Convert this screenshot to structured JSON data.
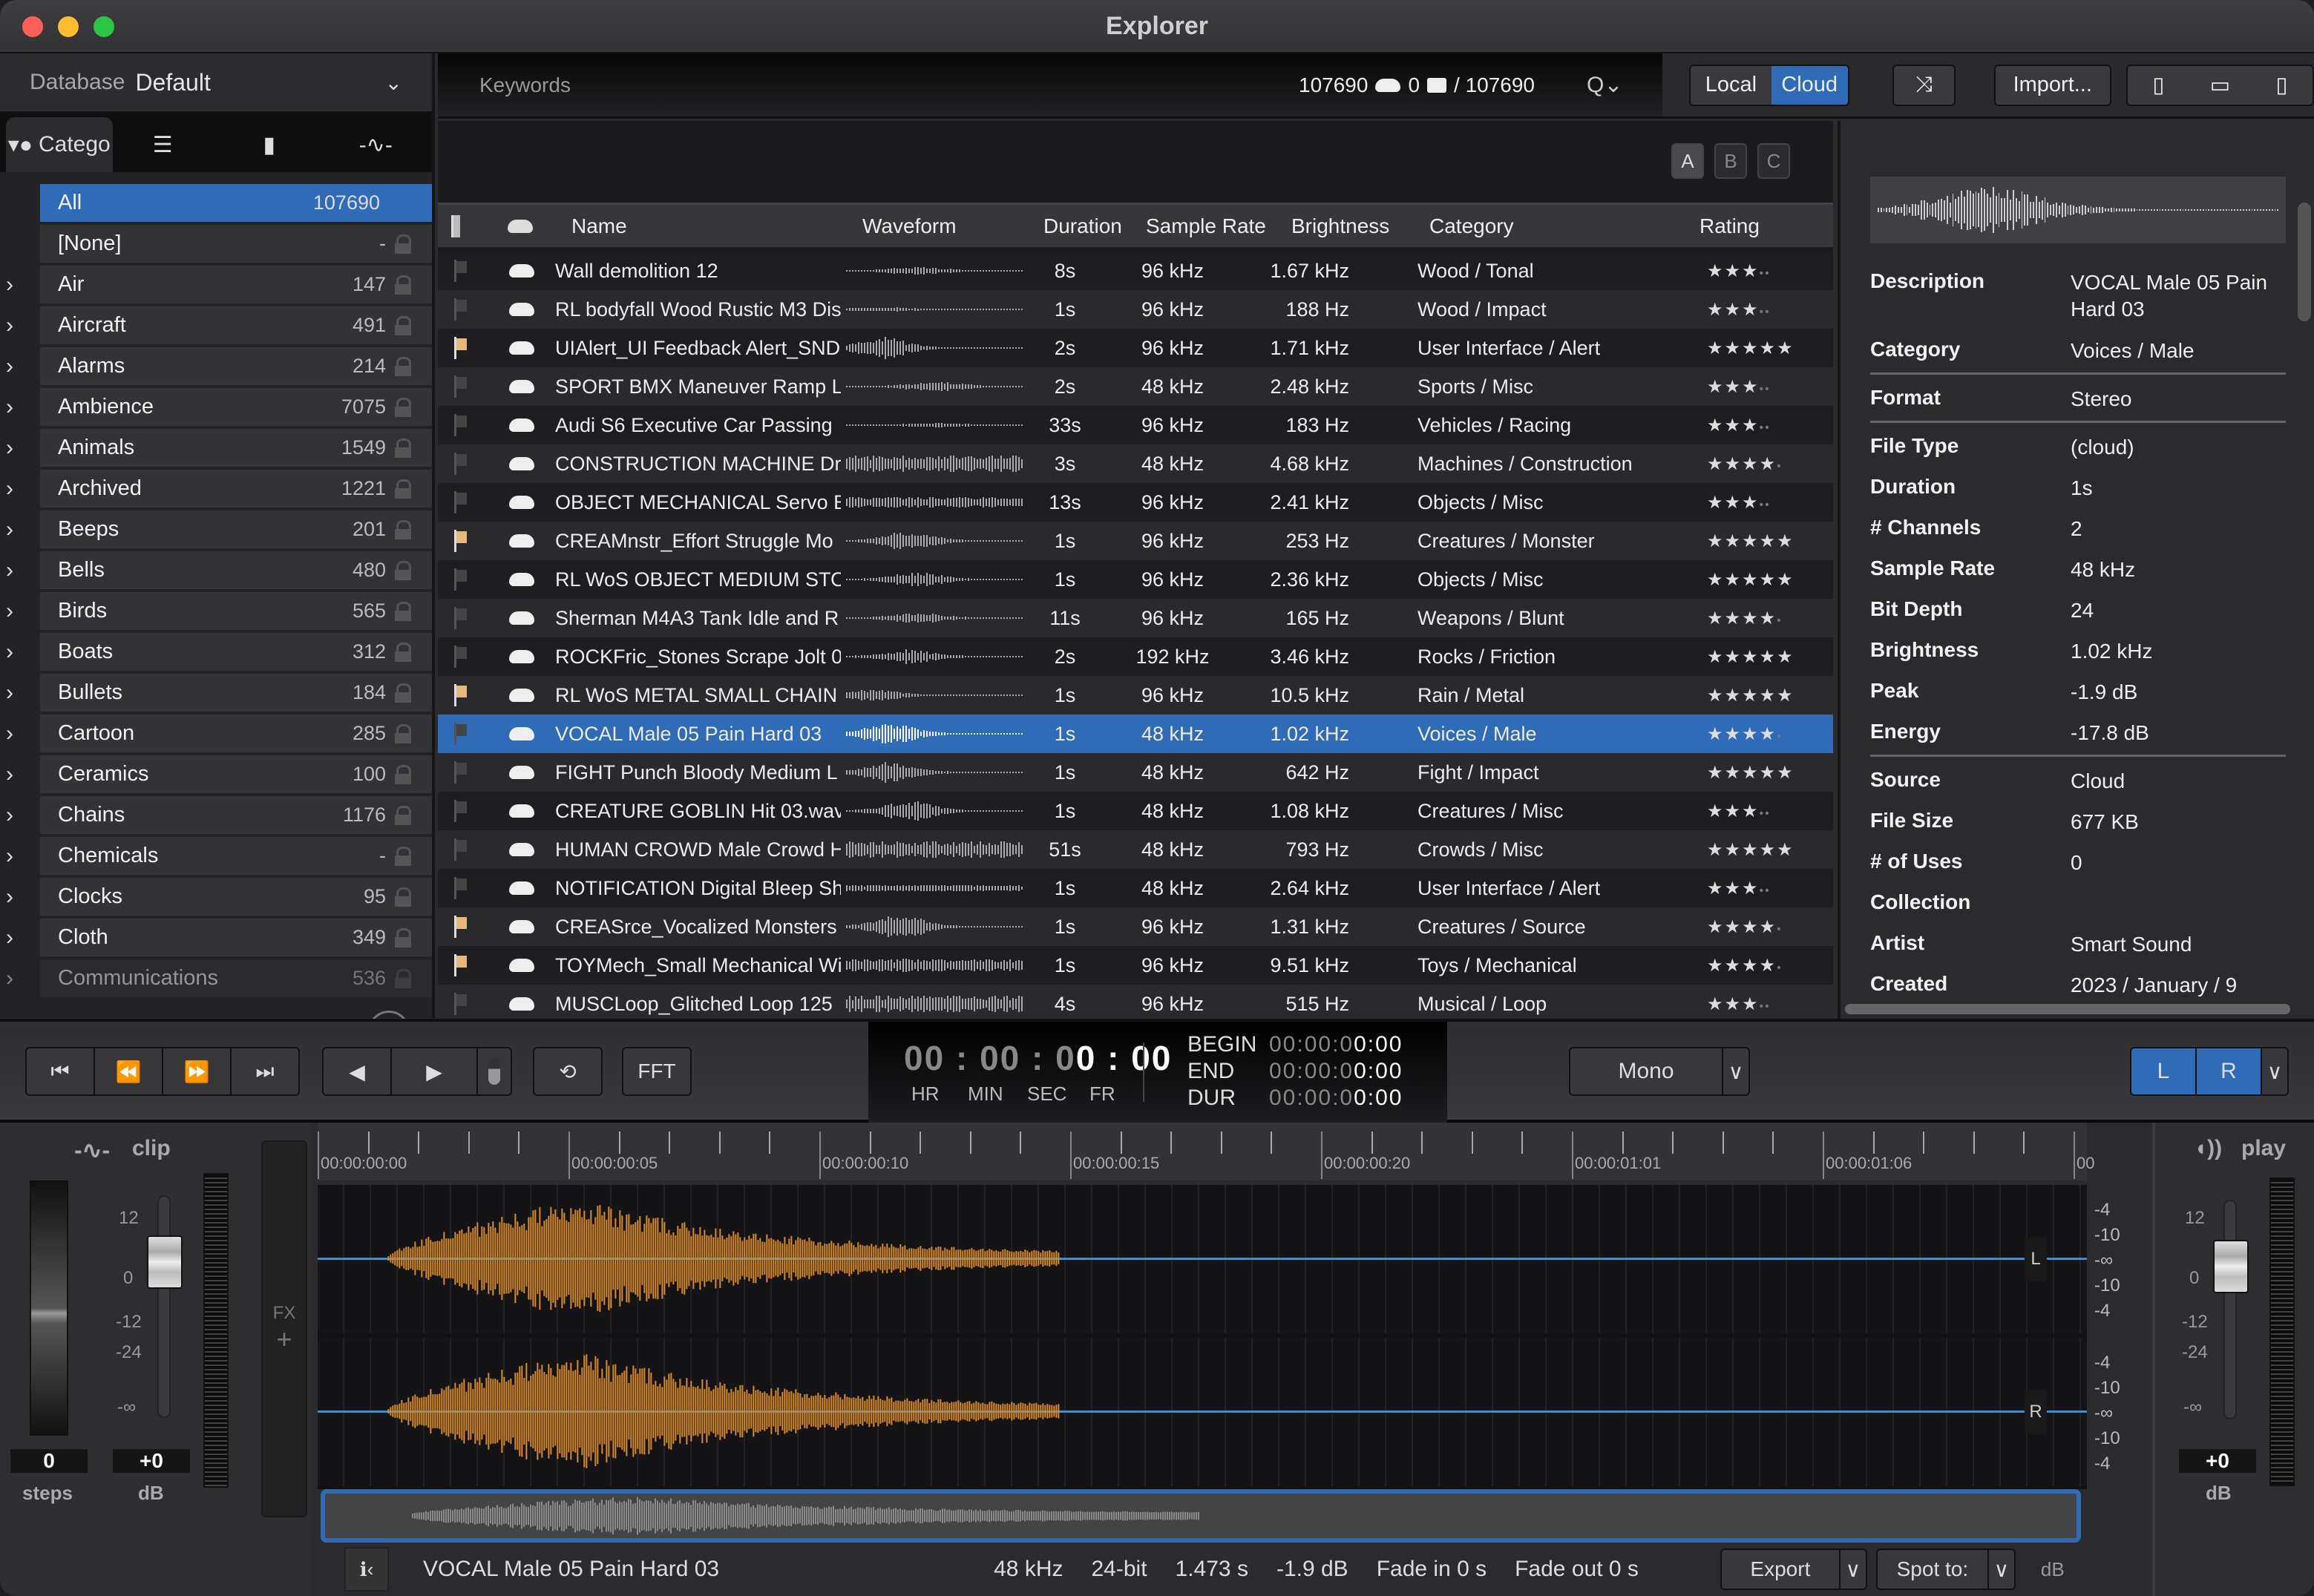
{
  "window": {
    "title": "Explorer"
  },
  "sidebar": {
    "database_label": "Database",
    "database_value": "Default",
    "tabs": [
      {
        "label": "Catego",
        "icon": "category-icon"
      },
      {
        "label": "",
        "icon": "list-icon"
      },
      {
        "label": "",
        "icon": "folder-icon"
      },
      {
        "label": "",
        "icon": "waveform-icon"
      }
    ],
    "categories": [
      {
        "name": "All",
        "count": "107690",
        "selected": true,
        "expandable": false
      },
      {
        "name": "[None]",
        "count": "-",
        "expandable": false
      },
      {
        "name": "Air",
        "count": "147",
        "expandable": true
      },
      {
        "name": "Aircraft",
        "count": "491",
        "expandable": true
      },
      {
        "name": "Alarms",
        "count": "214",
        "expandable": true
      },
      {
        "name": "Ambience",
        "count": "7075",
        "expandable": true
      },
      {
        "name": "Animals",
        "count": "1549",
        "expandable": true
      },
      {
        "name": "Archived",
        "count": "1221",
        "expandable": true
      },
      {
        "name": "Beeps",
        "count": "201",
        "expandable": true
      },
      {
        "name": "Bells",
        "count": "480",
        "expandable": true
      },
      {
        "name": "Birds",
        "count": "565",
        "expandable": true
      },
      {
        "name": "Boats",
        "count": "312",
        "expandable": true
      },
      {
        "name": "Bullets",
        "count": "184",
        "expandable": true
      },
      {
        "name": "Cartoon",
        "count": "285",
        "expandable": true
      },
      {
        "name": "Ceramics",
        "count": "100",
        "expandable": true
      },
      {
        "name": "Chains",
        "count": "1176",
        "expandable": true
      },
      {
        "name": "Chemicals",
        "count": "-",
        "expandable": true
      },
      {
        "name": "Clocks",
        "count": "95",
        "expandable": true
      },
      {
        "name": "Cloth",
        "count": "349",
        "expandable": true
      },
      {
        "name": "Communications",
        "count": "536",
        "expandable": true
      }
    ]
  },
  "search": {
    "placeholder": "Keywords",
    "cloud_count": "107690",
    "local_count": "0",
    "total": "/ 107690"
  },
  "toolbar": {
    "local_label": "Local",
    "cloud_label": "Cloud",
    "active_source": "Cloud",
    "import_label": "Import...",
    "abc": [
      "A",
      "B",
      "C"
    ]
  },
  "table": {
    "columns": [
      "Name",
      "Waveform",
      "Duration",
      "Sample Rate",
      "Brightness",
      "Category",
      "Rating"
    ],
    "rows": [
      {
        "flag": false,
        "name": "Wall demolition 12",
        "duration": "8s",
        "sample_rate": "96 kHz",
        "brightness": "1.67 kHz",
        "category": "Wood / Tonal",
        "rating": 3
      },
      {
        "flag": false,
        "name": "RL bodyfall Wood Rustic M3 Dis",
        "duration": "1s",
        "sample_rate": "96 kHz",
        "brightness": "188 Hz",
        "category": "Wood / Impact",
        "rating": 3
      },
      {
        "flag": true,
        "name": "UIAlert_UI Feedback Alert_SND",
        "duration": "2s",
        "sample_rate": "96 kHz",
        "brightness": "1.71 kHz",
        "category": "User Interface / Alert",
        "rating": 5
      },
      {
        "flag": false,
        "name": "SPORT BMX Maneuver Ramp L",
        "duration": "2s",
        "sample_rate": "48 kHz",
        "brightness": "2.48 kHz",
        "category": "Sports / Misc",
        "rating": 3
      },
      {
        "flag": false,
        "name": "Audi S6 Executive Car  Passing",
        "duration": "33s",
        "sample_rate": "96 kHz",
        "brightness": "183 Hz",
        "category": "Vehicles / Racing",
        "rating": 3
      },
      {
        "flag": false,
        "name": "CONSTRUCTION MACHINE Drill",
        "duration": "3s",
        "sample_rate": "48 kHz",
        "brightness": "4.68 kHz",
        "category": "Machines / Construction",
        "rating": 4
      },
      {
        "flag": false,
        "name": "OBJECT MECHANICAL Servo Bl",
        "duration": "13s",
        "sample_rate": "96 kHz",
        "brightness": "2.41 kHz",
        "category": "Objects / Misc",
        "rating": 3
      },
      {
        "flag": true,
        "name": "CREAMnstr_Effort Struggle Mo",
        "duration": "1s",
        "sample_rate": "96 kHz",
        "brightness": "253 Hz",
        "category": "Creatures / Monster",
        "rating": 5
      },
      {
        "flag": false,
        "name": "RL WoS OBJECT MEDIUM STO",
        "duration": "1s",
        "sample_rate": "96 kHz",
        "brightness": "2.36 kHz",
        "category": "Objects / Misc",
        "rating": 5
      },
      {
        "flag": false,
        "name": "Sherman M4A3 Tank  Idle and R",
        "duration": "11s",
        "sample_rate": "96 kHz",
        "brightness": "165 Hz",
        "category": "Weapons / Blunt",
        "rating": 4
      },
      {
        "flag": false,
        "name": "ROCKFric_Stones Scrape Jolt 0",
        "duration": "2s",
        "sample_rate": "192 kHz",
        "brightness": "3.46 kHz",
        "category": "Rocks / Friction",
        "rating": 5
      },
      {
        "flag": true,
        "name": "RL WoS METAL SMALL CHAIN",
        "duration": "1s",
        "sample_rate": "96 kHz",
        "brightness": "10.5 kHz",
        "category": "Rain / Metal",
        "rating": 5
      },
      {
        "flag": false,
        "name": "VOCAL Male 05 Pain Hard 03",
        "duration": "1s",
        "sample_rate": "48 kHz",
        "brightness": "1.02 kHz",
        "category": "Voices / Male",
        "rating": 4,
        "selected": true
      },
      {
        "flag": false,
        "name": "FIGHT Punch Bloody Medium L",
        "duration": "1s",
        "sample_rate": "48 kHz",
        "brightness": "642 Hz",
        "category": "Fight / Impact",
        "rating": 5
      },
      {
        "flag": false,
        "name": "CREATURE GOBLIN Hit 03.wav",
        "duration": "1s",
        "sample_rate": "48 kHz",
        "brightness": "1.08 kHz",
        "category": "Creatures / Misc",
        "rating": 3
      },
      {
        "flag": false,
        "name": "HUMAN CROWD Male Crowd H",
        "duration": "51s",
        "sample_rate": "48 kHz",
        "brightness": "793 Hz",
        "category": "Crowds / Misc",
        "rating": 5
      },
      {
        "flag": false,
        "name": "NOTIFICATION Digital Bleep Shr",
        "duration": "1s",
        "sample_rate": "48 kHz",
        "brightness": "2.64 kHz",
        "category": "User Interface / Alert",
        "rating": 3
      },
      {
        "flag": true,
        "name": "CREASrce_Vocalized Monsters",
        "duration": "1s",
        "sample_rate": "96 kHz",
        "brightness": "1.31 kHz",
        "category": "Creatures / Source",
        "rating": 4
      },
      {
        "flag": true,
        "name": "TOYMech_Small Mechanical Wi",
        "duration": "1s",
        "sample_rate": "96 kHz",
        "brightness": "9.51 kHz",
        "category": "Toys / Mechanical",
        "rating": 4
      },
      {
        "flag": false,
        "name": "MUSCLoop_Glitched Loop 125",
        "duration": "4s",
        "sample_rate": "96 kHz",
        "brightness": "515 Hz",
        "category": "Musical / Loop",
        "rating": 3
      }
    ]
  },
  "info": {
    "groups": [
      [
        {
          "key": "Description",
          "value": "VOCAL Male 05 Pain Hard 03"
        },
        {
          "key": "Category",
          "value": "Voices / Male"
        }
      ],
      [
        {
          "key": "Format",
          "value": "Stereo"
        }
      ],
      [
        {
          "key": "File Type",
          "value": "(cloud)"
        },
        {
          "key": "Duration",
          "value": "1s"
        },
        {
          "key": "# Channels",
          "value": "2"
        },
        {
          "key": "Sample Rate",
          "value": "48 kHz"
        },
        {
          "key": "Bit Depth",
          "value": "24"
        },
        {
          "key": "Brightness",
          "value": "1.02 kHz"
        },
        {
          "key": "Peak",
          "value": "-1.9 dB"
        },
        {
          "key": "Energy",
          "value": "-17.8 dB"
        }
      ],
      [
        {
          "key": "Source",
          "value": "Cloud"
        },
        {
          "key": "File Size",
          "value": "677 KB"
        },
        {
          "key": "# of Uses",
          "value": "0"
        },
        {
          "key": "Collection",
          "value": ""
        },
        {
          "key": "Artist",
          "value": "Smart Sound"
        },
        {
          "key": "Created",
          "value": "2023 / January /  9"
        }
      ]
    ]
  },
  "transport": {
    "fft_label": "FFT",
    "timecode": {
      "hr": "00",
      "min": "00",
      "sec_dim": "0",
      "sec": "0",
      "fr": "00"
    },
    "timecode_labels": [
      "HR",
      "MIN",
      "SEC",
      "FR"
    ],
    "begin_label": "BEGIN",
    "begin_value_dim": "00:00:0",
    "begin_value": "0:00",
    "end_label": "END",
    "end_value_dim": "00:00:0",
    "end_value": "0:00",
    "dur_label": "DUR",
    "dur_value_dim": "00:00:0",
    "dur_value": "0:00",
    "mono_label": "Mono",
    "channel_l": "L",
    "channel_r": "R"
  },
  "clip_panel": {
    "title": "clip",
    "steps_value": "0",
    "steps_label": "steps",
    "gain_value": "+0",
    "gain_label": "dB",
    "scale": [
      "12",
      "0",
      "-12",
      "-24",
      "-∞"
    ],
    "fx_label": "FX"
  },
  "play_panel": {
    "title": "play",
    "gain_value": "+0",
    "gain_label": "dB",
    "scale": [
      "12",
      "0",
      "-12",
      "-24",
      "-∞"
    ],
    "meter_label": "dB"
  },
  "timeline": {
    "labels": [
      "00:00:00:00",
      "00:00:00:05",
      "00:00:00:10",
      "00:00:00:15",
      "00:00:00:20",
      "00:00:01:01",
      "00:00:01:06",
      "00"
    ],
    "channel_labels": [
      "L",
      "R"
    ],
    "db_scale": [
      "-4",
      "-10",
      "-∞",
      "-10",
      "-4"
    ]
  },
  "statusbar": {
    "filename": "VOCAL Male 05 Pain Hard 03",
    "sample_rate": "48 kHz",
    "bit_depth": "24-bit",
    "length": "1.473 s",
    "peak": "-1.9 dB",
    "fade_in": "Fade in 0 s",
    "fade_out": "Fade out 0 s",
    "export_label": "Export",
    "spot_label": "Spot to:"
  },
  "colors": {
    "accent": "#2f6bb7",
    "waveform": "#d98b2b",
    "flag": "#e4b87e"
  }
}
